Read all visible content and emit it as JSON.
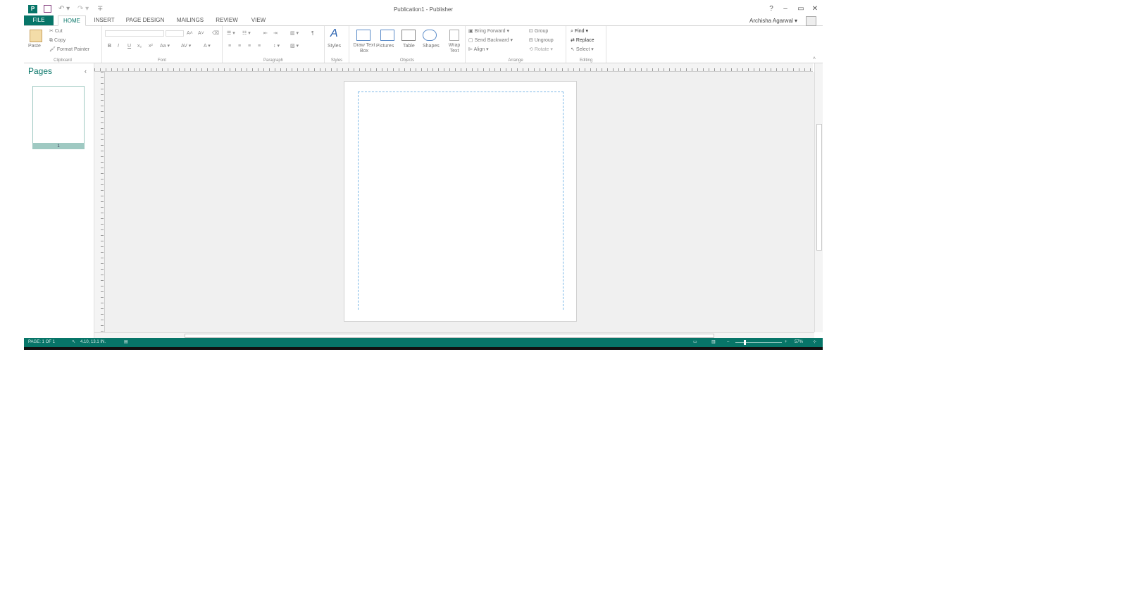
{
  "window": {
    "title": "Publication1 - Publisher",
    "logo": "P",
    "help": "?",
    "minimize": "–",
    "restore": "▭",
    "close": "✕"
  },
  "qat": {
    "undo": "↶ ▾",
    "redo": "↷ ▾",
    "customize": "∓"
  },
  "tabs": [
    {
      "label": "FILE"
    },
    {
      "label": "HOME"
    },
    {
      "label": "INSERT"
    },
    {
      "label": "PAGE DESIGN"
    },
    {
      "label": "MAILINGS"
    },
    {
      "label": "REVIEW"
    },
    {
      "label": "VIEW"
    }
  ],
  "account": {
    "name": "Archisha Agarwal ▾"
  },
  "ribbon": {
    "clipboard": {
      "label": "Clipboard",
      "paste": "Paste",
      "cut": "Cut",
      "copy": "Copy",
      "format_painter": "Format Painter"
    },
    "font": {
      "label": "Font",
      "bold": "B",
      "italic": "I",
      "underline": "U",
      "subscript": "x₂",
      "superscript": "x²",
      "case": "Aa ▾",
      "grow": "A˄",
      "shrink": "A˅"
    },
    "paragraph": {
      "label": "Paragraph",
      "marks": "¶"
    },
    "styles": {
      "label": "Styles",
      "button": "Styles"
    },
    "objects": {
      "label": "Objects",
      "draw_text_box": "Draw Text Box",
      "pictures": "Pictures",
      "table": "Table",
      "shapes": "Shapes",
      "wrap_text": "Wrap Text"
    },
    "arrange": {
      "label": "Arrange",
      "bring_forward": "Bring Forward",
      "send_backward": "Send Backward",
      "align": "Align",
      "group": "Group",
      "ungroup": "Ungroup",
      "rotate": "Rotate"
    },
    "editing": {
      "label": "Editing",
      "find": "Find",
      "replace": "Replace",
      "select": "Select"
    }
  },
  "pages_pane": {
    "title": "Pages",
    "collapse": "‹",
    "page_number": "1"
  },
  "status": {
    "page": "PAGE: 1 OF 1",
    "position": "4.10, 13.1 IN.",
    "zoom": "57%"
  },
  "colors": {
    "accent": "#077568",
    "guide": "#7cb8e6"
  }
}
